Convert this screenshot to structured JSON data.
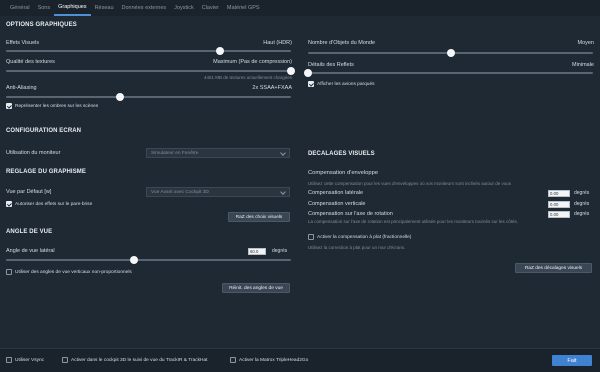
{
  "tabs": [
    {
      "label": "Général"
    },
    {
      "label": "Sons"
    },
    {
      "label": "Graphiques"
    },
    {
      "label": "Réseau"
    },
    {
      "label": "Données externes"
    },
    {
      "label": "Joystick"
    },
    {
      "label": "Clavier"
    },
    {
      "label": "Matériel GPS"
    }
  ],
  "graphics": {
    "title": "OPTIONS GRAPHIQUES",
    "visual_effects": {
      "label": "Effets Visuels",
      "value": "Haut (HDR)",
      "level": 0.75
    },
    "texture_quality": {
      "label": "Qualité des textures",
      "value": "Maximum (Pas de compression)",
      "level": 1.0,
      "note": "4451 MB de textures actuellement chargées"
    },
    "anti_aliasing": {
      "label": "Anti-Aliasing",
      "value": "2x SSAA+FXAA",
      "level": 0.4
    },
    "render_shadows": {
      "label": "Représenter les ombres sur les scènes",
      "checked": true
    },
    "world_objects": {
      "label": "Nombre d'Objets du Monde",
      "value": "Moyen",
      "level": 0.5
    },
    "reflections": {
      "label": "Détails des Reflets",
      "value": "Minimale",
      "level": 0.0
    },
    "show_parked": {
      "label": "Afficher les avions parqués",
      "checked": true
    }
  },
  "screen": {
    "title": "CONFIGURATION ECRAN",
    "monitor_label": "Utilisation du moniteur",
    "monitor_value": "Simulateur en Fenêtre"
  },
  "graphism": {
    "title": "REGLAGE DU GRAPHISME",
    "default_view_label": "Vue par Défaut [w]",
    "default_view_value": "Vue Avant avec Cockpit 3D",
    "windshield": {
      "label": "Autoriser des effets sur le pare-brise",
      "checked": true
    },
    "reset_views_button": "RaZ des choix visuels"
  },
  "view_angle": {
    "title": "ANGLE DE VUE",
    "lateral_label": "Angle de vue latéral",
    "lateral_value": "60.0",
    "unit": "degrés",
    "level": 0.45,
    "nonproportional": {
      "label": "Utiliser des angles de vue verticaux non-proportionnels",
      "checked": false
    },
    "reset_button": "Réinit. des angles de vue"
  },
  "visual_offsets": {
    "title": "DECALAGES VISUELS",
    "envelope_title": "Compensation d'enveloppe",
    "envelope_note": "Utilisez cette compensation pour les vues d'enveloppes où vos moniteurs sont inclinés autour de vous",
    "lateral": {
      "label": "Compensation latérale",
      "value": "0.00",
      "unit": "degrés"
    },
    "vertical": {
      "label": "Compensation verticale",
      "value": "0.00",
      "unit": "degrés"
    },
    "rotation": {
      "label": "Compensation sur l'axe de rotation",
      "value": "0.00",
      "unit": "degrés"
    },
    "rotation_note": "La compensation sur l'axe de rotation est principalement utilisée pour les moniteurs tournés sur les côtés.",
    "ground_comp": {
      "label": "Activer la compensation à plat (fractionnelle)",
      "checked": false
    },
    "ground_note": "Utilisez la correction à plat pour un mur d'écrans.",
    "reset_button": "RaZ des décalages visuels"
  },
  "footer": {
    "vsync": {
      "label": "Utiliser Vsync",
      "checked": false
    },
    "trackir": {
      "label": "Activer dans le cockpit 3D le suivi de vue du TrackIR & TrackHat",
      "checked": false
    },
    "matrox": {
      "label": "Activer la Matrox TripleHead2Go",
      "checked": false
    },
    "done_button": "Fait"
  }
}
